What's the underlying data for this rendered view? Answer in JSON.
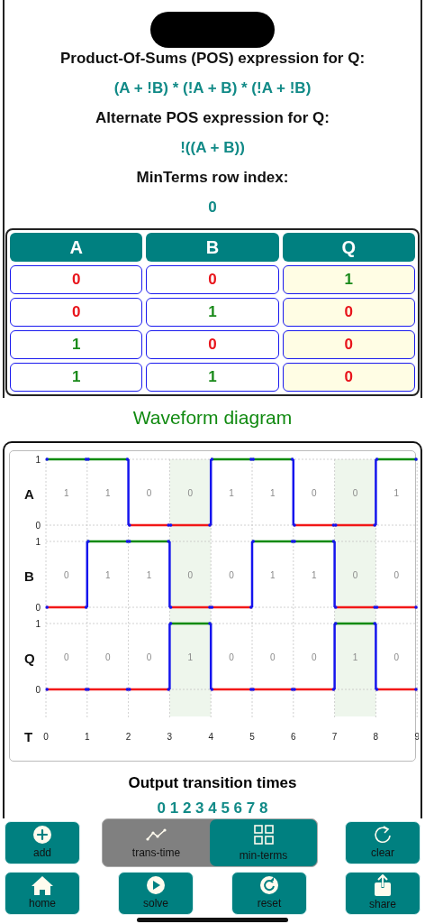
{
  "expressions": [
    {
      "label": "Product-Of-Sums (POS) expression for Q:",
      "value": "(A + !B) * (!A + B) * (!A + !B)"
    },
    {
      "label": "Alternate POS expression for Q:",
      "value": "!((A + B))"
    },
    {
      "label": "MinTerms row index:",
      "value": "0"
    }
  ],
  "truth_table": {
    "columns": [
      {
        "label": "A",
        "kind": "input"
      },
      {
        "label": "B",
        "kind": "input"
      },
      {
        "label": "Q",
        "kind": "output"
      }
    ],
    "rows": [
      [
        {
          "value": "0",
          "color": "#e8141b"
        },
        {
          "value": "0",
          "color": "#e8141b"
        },
        {
          "value": "1",
          "color": "#1a8a1a"
        }
      ],
      [
        {
          "value": "0",
          "color": "#e8141b"
        },
        {
          "value": "1",
          "color": "#1a8a1a"
        },
        {
          "value": "0",
          "color": "#e8141b"
        }
      ],
      [
        {
          "value": "1",
          "color": "#1a8a1a"
        },
        {
          "value": "0",
          "color": "#e8141b"
        },
        {
          "value": "0",
          "color": "#e8141b"
        }
      ],
      [
        {
          "value": "1",
          "color": "#1a8a1a"
        },
        {
          "value": "1",
          "color": "#1a8a1a"
        },
        {
          "value": "0",
          "color": "#e8141b"
        }
      ]
    ]
  },
  "waveform": {
    "title": "Waveform diagram",
    "time_label": "T",
    "times": [
      "0",
      "1",
      "2",
      "3",
      "4",
      "5",
      "6",
      "7",
      "8",
      "9"
    ],
    "signals": [
      {
        "name": "A",
        "high_tick": "1",
        "low_tick": "0",
        "kind": "input",
        "intervals": [
          {
            "label": "1",
            "high": true
          },
          {
            "label": "1",
            "high": true
          },
          {
            "label": "0",
            "high": false
          },
          {
            "label": "0",
            "high": false
          },
          {
            "label": "1",
            "high": true
          },
          {
            "label": "1",
            "high": true
          },
          {
            "label": "0",
            "high": false
          },
          {
            "label": "0",
            "high": false
          },
          {
            "label": "1",
            "high": true
          }
        ]
      },
      {
        "name": "B",
        "high_tick": "1",
        "low_tick": "0",
        "kind": "input",
        "intervals": [
          {
            "label": "0",
            "high": false
          },
          {
            "label": "1",
            "high": true
          },
          {
            "label": "1",
            "high": true
          },
          {
            "label": "0",
            "high": false
          },
          {
            "label": "0",
            "high": false
          },
          {
            "label": "1",
            "high": true
          },
          {
            "label": "1",
            "high": true
          },
          {
            "label": "0",
            "high": false
          },
          {
            "label": "0",
            "high": false
          }
        ]
      },
      {
        "name": "Q",
        "high_tick": "1",
        "low_tick": "0",
        "kind": "output",
        "intervals": [
          {
            "label": "0",
            "high": false
          },
          {
            "label": "0",
            "high": false
          },
          {
            "label": "0",
            "high": false
          },
          {
            "label": "1",
            "high": true
          },
          {
            "label": "0",
            "high": false
          },
          {
            "label": "0",
            "high": false
          },
          {
            "label": "0",
            "high": false
          },
          {
            "label": "1",
            "high": true
          },
          {
            "label": "0",
            "high": false
          }
        ]
      }
    ]
  },
  "transitions": {
    "title": "Output transition times",
    "value": "0 1 2 3 4 5 6 7 8"
  },
  "toolbar": {
    "add": "add",
    "segments": [
      {
        "label": "trans-time",
        "selected": false
      },
      {
        "label": "min-terms",
        "selected": true
      }
    ],
    "clear": "clear",
    "bottom": [
      "home",
      "solve",
      "reset",
      "share"
    ]
  }
}
